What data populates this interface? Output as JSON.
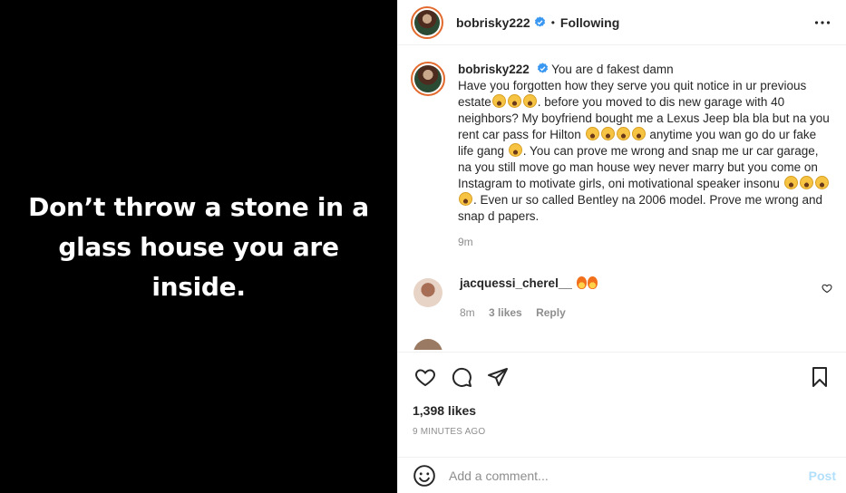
{
  "media": {
    "text": "Don’t throw a stone in a glass house you are inside."
  },
  "header": {
    "username": "bobrisky222",
    "separator": "•",
    "follow_state": "Following",
    "more_icon": "more-horizontal-icon"
  },
  "caption": {
    "username": "bobrisky222",
    "text_1": "You are d fakest damn",
    "text_2": "Have you forgotten how they serve you quit notice in ur previous estate",
    "text_3": ". before you moved to dis new garage with 40 neighbors? My boyfriend bought me a Lexus Jeep bla bla but na you rent car pass for Hilton ",
    "text_4": " anytime you wan go do ur fake life gang ",
    "text_5": ". You can prove me wrong and snap me ur car garage, na you still move go man house wey never marry but you come on Instagram to motivate girls, oni motivational speaker insonu ",
    "text_6": ". Even ur so called Bentley na 2006 model. Prove me wrong and snap d papers.",
    "time": "9m"
  },
  "comments": [
    {
      "username": "jacquessi_cherel__",
      "time": "8m",
      "likes": "3 likes",
      "reply": "Reply"
    }
  ],
  "actions": {
    "likes": "1,398 likes",
    "time_ago": "9 MINUTES AGO"
  },
  "add_comment": {
    "placeholder": "Add a comment...",
    "post": "Post"
  },
  "colors": {
    "verified": "#3897f0",
    "post_disabled": "#b2dffc",
    "muted": "#8e8e8e"
  }
}
